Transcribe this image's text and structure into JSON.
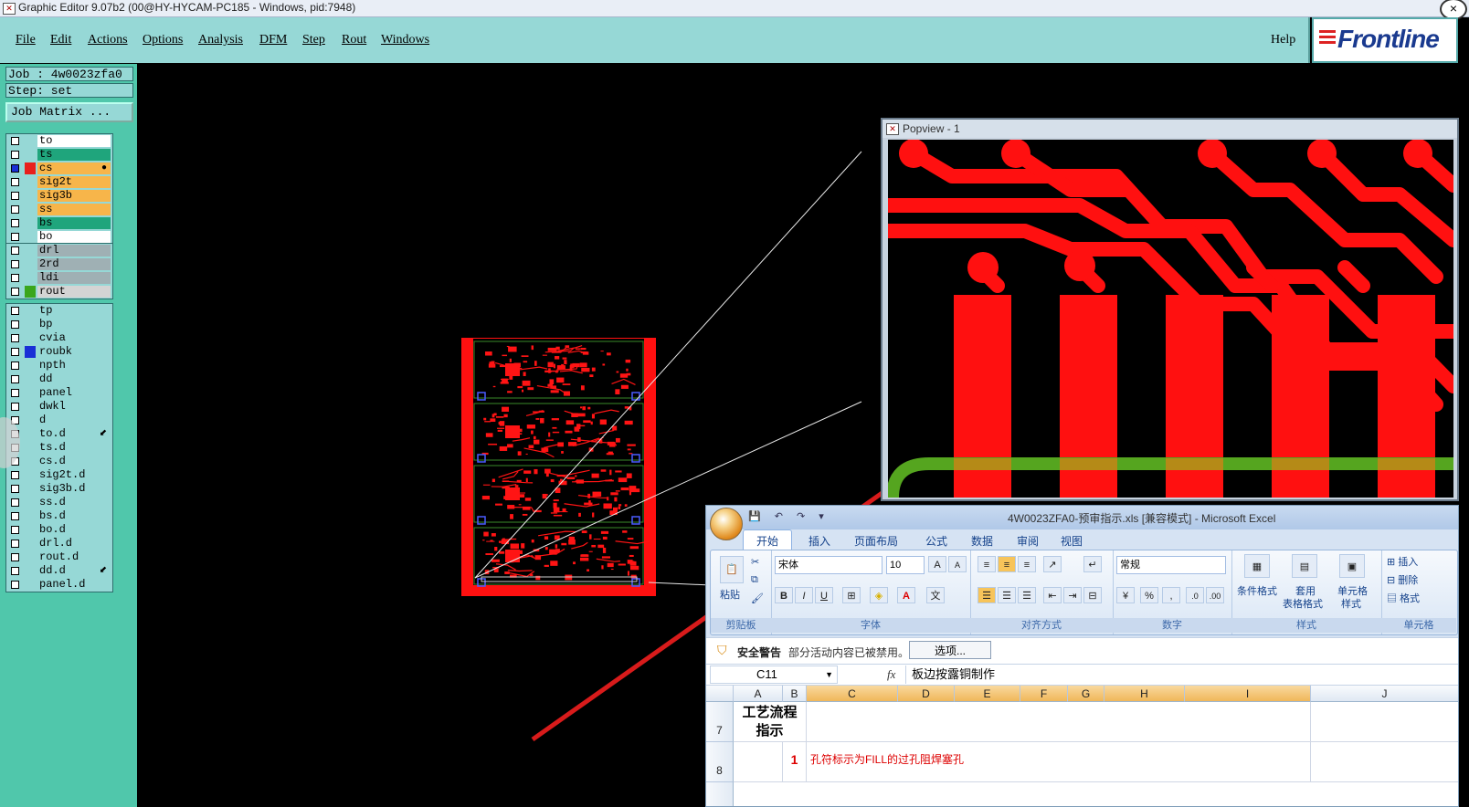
{
  "window": {
    "title": "Graphic Editor 9.07b2 (00@HY-HYCAM-PC185 - Windows, pid:7948)",
    "close_glyph": "×"
  },
  "menubar": {
    "items": [
      "File",
      "Edit",
      "Actions",
      "Options",
      "Analysis",
      "DFM",
      "Step",
      "Rout",
      "Windows"
    ],
    "help": "Help",
    "brand": "Frontline"
  },
  "job_panel": {
    "job": "Job : 4w0023zfa0",
    "step": "Step: set",
    "matrix_button": "Job Matrix ..."
  },
  "layer_groups": [
    [
      {
        "name": "to",
        "bg": "#ffffff",
        "swatch": "",
        "checked": false
      },
      {
        "name": "ts",
        "bg": "#1fa57c",
        "swatch": "",
        "checked": false
      },
      {
        "name": "cs",
        "bg": "#f7b54a",
        "swatch": "#e8201c",
        "checked": true,
        "mark": "●"
      },
      {
        "name": "sig2t",
        "bg": "#f7b54a",
        "swatch": "",
        "checked": false
      },
      {
        "name": "sig3b",
        "bg": "#f7b54a",
        "swatch": "",
        "checked": false
      },
      {
        "name": "ss",
        "bg": "#f7b54a",
        "swatch": "",
        "checked": false
      },
      {
        "name": "bs",
        "bg": "#1fa57c",
        "swatch": "",
        "checked": false
      },
      {
        "name": "bo",
        "bg": "#ffffff",
        "swatch": "",
        "checked": false
      }
    ],
    [
      {
        "name": "drl",
        "bg": "#9fb0b4",
        "swatch": "",
        "checked": false
      },
      {
        "name": "2rd",
        "bg": "#9fb0b4",
        "swatch": "",
        "checked": false
      },
      {
        "name": "ldi",
        "bg": "#9fb0b4",
        "swatch": "",
        "checked": false
      },
      {
        "name": "rout",
        "bg": "#d4d4d4",
        "swatch": "#3aa61c",
        "checked": false
      }
    ],
    [
      {
        "name": "tp",
        "bg": "#96d8d6",
        "swatch": "",
        "checked": false
      },
      {
        "name": "bp",
        "bg": "#96d8d6",
        "swatch": "",
        "checked": false
      },
      {
        "name": "cvia",
        "bg": "#96d8d6",
        "swatch": "",
        "checked": false
      },
      {
        "name": "roubk",
        "bg": "#96d8d6",
        "swatch": "#1a2fd6",
        "checked": false
      },
      {
        "name": "npth",
        "bg": "#96d8d6",
        "swatch": "",
        "checked": false
      },
      {
        "name": "dd",
        "bg": "#96d8d6",
        "swatch": "",
        "checked": false
      },
      {
        "name": "panel",
        "bg": "#96d8d6",
        "swatch": "",
        "checked": false
      },
      {
        "name": "dwkl",
        "bg": "#96d8d6",
        "swatch": "",
        "checked": false
      },
      {
        "name": "d",
        "bg": "#96d8d6",
        "swatch": "",
        "checked": false
      },
      {
        "name": "to.d",
        "bg": "#96d8d6",
        "swatch": "",
        "checked": false,
        "mark": "⬋"
      },
      {
        "name": "ts.d",
        "bg": "#96d8d6",
        "swatch": "",
        "checked": false
      },
      {
        "name": "cs.d",
        "bg": "#96d8d6",
        "swatch": "",
        "checked": false
      },
      {
        "name": "sig2t.d",
        "bg": "#96d8d6",
        "swatch": "",
        "checked": false
      },
      {
        "name": "sig3b.d",
        "bg": "#96d8d6",
        "swatch": "",
        "checked": false
      },
      {
        "name": "ss.d",
        "bg": "#96d8d6",
        "swatch": "",
        "checked": false
      },
      {
        "name": "bs.d",
        "bg": "#96d8d6",
        "swatch": "",
        "checked": false
      },
      {
        "name": "bo.d",
        "bg": "#96d8d6",
        "swatch": "",
        "checked": false
      },
      {
        "name": "drl.d",
        "bg": "#96d8d6",
        "swatch": "",
        "checked": false
      },
      {
        "name": "rout.d",
        "bg": "#96d8d6",
        "swatch": "",
        "checked": false
      },
      {
        "name": "dd.d",
        "bg": "#96d8d6",
        "swatch": "",
        "checked": false,
        "mark": "⬋"
      },
      {
        "name": "panel.d",
        "bg": "#96d8d6",
        "swatch": "",
        "checked": false
      }
    ]
  ],
  "popview": {
    "title": "Popview - 1"
  },
  "excel": {
    "title": "4W0023ZFA0-预审指示.xls  [兼容模式] - Microsoft Excel",
    "qat": "💾 ↶ ↷ ▾",
    "tabs": [
      "开始",
      "插入",
      "页面布局",
      "公式",
      "数据",
      "审阅",
      "视图"
    ],
    "ribbon": {
      "clipboard_label": "剪贴板",
      "paste": "粘贴",
      "font_label": "字体",
      "font_name": "宋体",
      "font_size": "10",
      "align_label": "对齐方式",
      "number_label": "数字",
      "number_format": "常规",
      "styles_label": "样式",
      "cond_format": "条件格式",
      "table_format_1": "套用",
      "table_format_2": "表格格式",
      "cell_style_1": "单元格",
      "cell_style_2": "样式",
      "cells_label": "单元格",
      "insert": "插入",
      "delete": "删除",
      "format": "格式"
    },
    "security": {
      "title": "安全警告",
      "message": "部分活动内容已被禁用。",
      "options_button": "选项..."
    },
    "formula_bar": {
      "name_box": "C11",
      "fx": "fx",
      "content": "板边按露铜制作"
    },
    "columns": [
      "A",
      "B",
      "C",
      "D",
      "E",
      "F",
      "G",
      "H",
      "I",
      "J"
    ],
    "rows": [
      {
        "num": "7",
        "a_line1": "工艺流程",
        "a_line2": "指示",
        "b": "",
        "c": ""
      },
      {
        "num": "8",
        "a_line1": "",
        "a_line2": "",
        "b": "1",
        "c": "孔符标示为FILL的过孔阻焊塞孔"
      }
    ]
  },
  "colors": {
    "menubar": "#96d8d6",
    "left_panel": "#50c7ab",
    "copper": "#ff1010",
    "rout": "#55a51f"
  }
}
